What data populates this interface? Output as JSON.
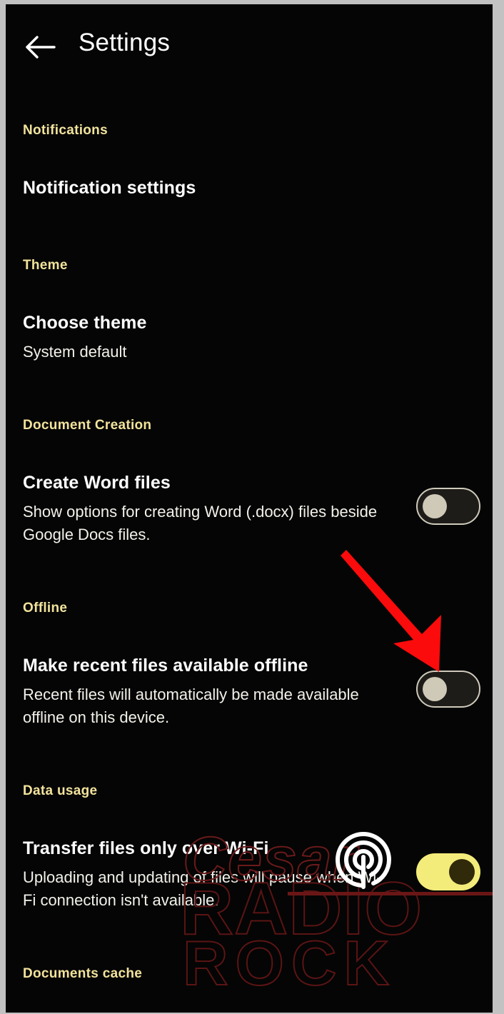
{
  "app": {
    "title": "Settings",
    "back_icon": "back-arrow-icon"
  },
  "colors": {
    "background": "#050505",
    "section_header": "#f2e39c",
    "primary_text": "#ffffff",
    "secondary_text": "#f3f1ea",
    "toggle_on": "#f4ec7a",
    "toggle_off_border": "#cfcabb",
    "annotation": "#ff0000",
    "watermark": "#6b1a1a",
    "frame": "#c2c2c2"
  },
  "sections": [
    {
      "header": "Notifications",
      "rows": [
        {
          "title": "Notification settings",
          "subtitle": "",
          "toggle": null
        }
      ]
    },
    {
      "header": "Theme",
      "rows": [
        {
          "title": "Choose theme",
          "subtitle": "System default",
          "toggle": null
        }
      ]
    },
    {
      "header": "Document Creation",
      "rows": [
        {
          "title": "Create Word files",
          "subtitle": "Show options for creating Word (.docx) files beside Google Docs files.",
          "toggle": "off"
        }
      ]
    },
    {
      "header": "Offline",
      "rows": [
        {
          "title": "Make recent files available offline",
          "subtitle": "Recent files will automatically be made available offline on this device.",
          "toggle": "off"
        }
      ]
    },
    {
      "header": "Data usage",
      "rows": [
        {
          "title": "Transfer files only over Wi-Fi",
          "subtitle": "Uploading and updating of files will pause when Wi-Fi connection isn't available.",
          "toggle": "on"
        }
      ]
    },
    {
      "header": "Documents cache",
      "rows": []
    }
  ],
  "watermark": {
    "line1": "Cesar",
    "line2": "RADIO",
    "line3": "ROCK",
    "logo_icon": "radio-waves-icon"
  },
  "annotation": {
    "type": "arrow",
    "points_to": "offline-toggle"
  }
}
